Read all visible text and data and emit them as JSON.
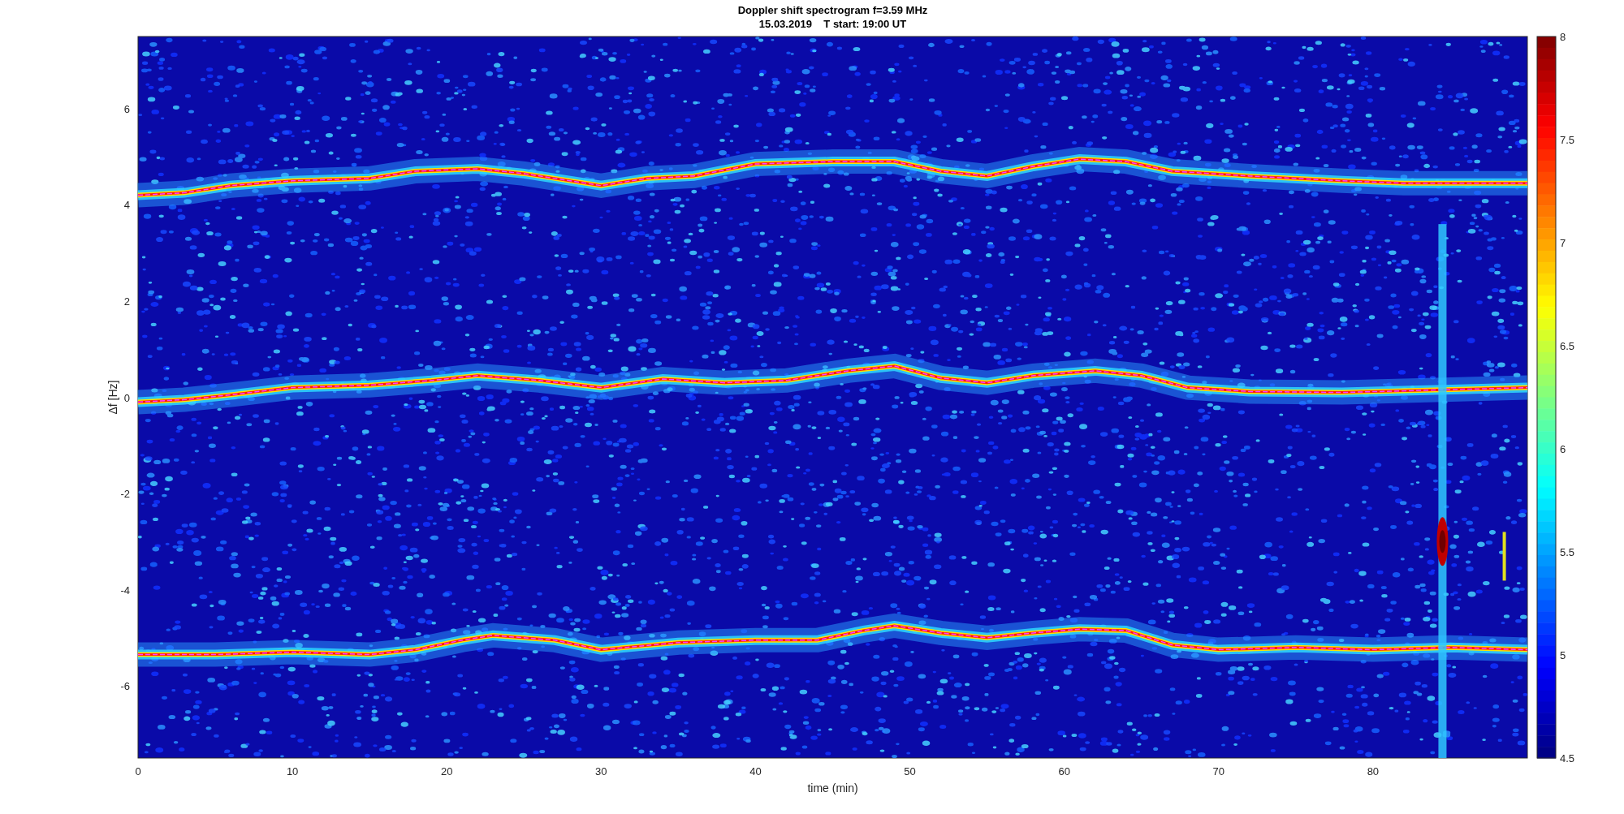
{
  "figure": {
    "title_lines": [
      "Doppler shift spectrogram f=3.59 MHz",
      "15.03.2019    T start: 19:00 UT"
    ]
  },
  "x_axis": {
    "label": "time (min)",
    "ticks": [
      "0",
      "10",
      "20",
      "30",
      "40",
      "50",
      "60",
      "70",
      "80"
    ]
  },
  "y_axis": {
    "label": "Δf [Hz]",
    "ticks": [
      "6",
      "4",
      "2",
      "0",
      "-2",
      "-4",
      "-6"
    ]
  },
  "colorbar": {
    "ticks": [
      "8",
      "7.5",
      "7",
      "6.5",
      "6",
      "5.5",
      "5",
      "4.5"
    ]
  }
}
